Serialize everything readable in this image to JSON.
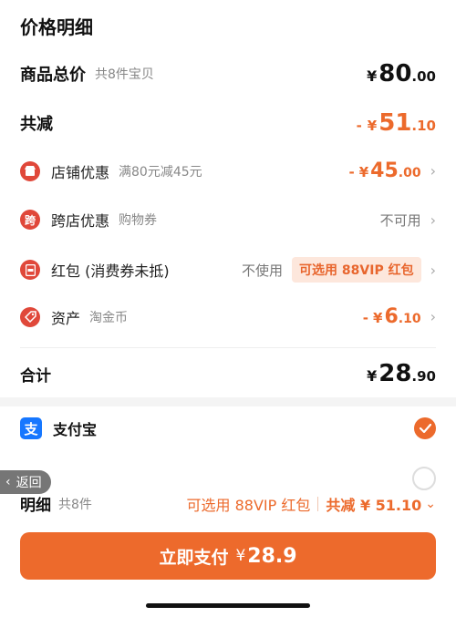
{
  "header": {
    "title": "价格明细"
  },
  "goods": {
    "label": "商品总价",
    "count": "共8件宝贝",
    "currency": "¥",
    "int": "80",
    "dec": ".00"
  },
  "reduction": {
    "label": "共减",
    "prefix": "-",
    "currency": "¥",
    "int": "51",
    "dec": ".10"
  },
  "shop_discount": {
    "label": "店铺优惠",
    "desc": "满80元减45元",
    "prefix": "-",
    "currency": "¥",
    "int": "45",
    "dec": ".00",
    "chevron": "›",
    "icon": "shop-icon"
  },
  "cross_discount": {
    "label": "跨店优惠",
    "desc": "购物券",
    "icon_text": "跨",
    "status": "不可用",
    "chevron": "›",
    "icon": "cross-store-icon"
  },
  "red_packet": {
    "label": "红包 (消费券未抵)",
    "status": "不使用",
    "chip": "可选用 88VIP 红包",
    "chevron": "›",
    "icon": "red-packet-icon"
  },
  "assets": {
    "label": "资产",
    "desc": "淘金币",
    "prefix": "-",
    "currency": "¥",
    "int": "6",
    "dec": ".10",
    "chevron": "›",
    "icon": "coin-tag-icon"
  },
  "total": {
    "label": "合计",
    "currency": "¥",
    "int": "28",
    "dec": ".90"
  },
  "payment": {
    "method": "支付宝",
    "icon_text": "支",
    "selected": true
  },
  "back": {
    "label": "返回"
  },
  "summary": {
    "label": "明细",
    "count": "共8件",
    "vip": "可选用 88VIP 红包",
    "total": "共减 ¥ 51.10",
    "chevron": "⌄"
  },
  "pay_button": {
    "label": "立即支付",
    "currency": "¥",
    "amount": "28.9"
  },
  "colors": {
    "accent": "#ec6a2c",
    "alipay": "#1677ff",
    "icon_red": "#e0483a"
  }
}
